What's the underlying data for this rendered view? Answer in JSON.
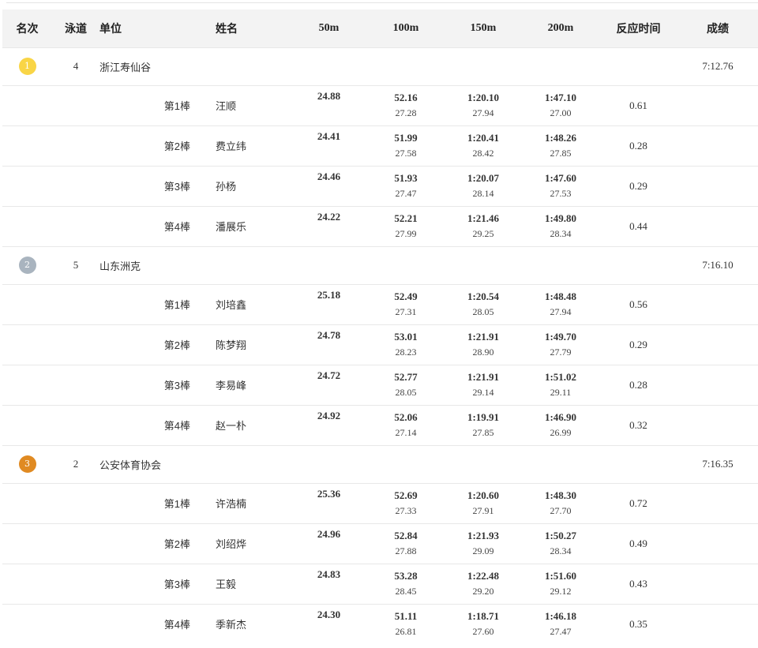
{
  "headers": {
    "rank": "名次",
    "lane": "泳道",
    "unit": "单位",
    "name": "姓名",
    "s50": "50m",
    "s100": "100m",
    "s150": "150m",
    "s200": "200m",
    "reaction": "反应时间",
    "result": "成绩"
  },
  "teams": [
    {
      "rank": "1",
      "medal_color": "#f9d546",
      "lane": "4",
      "unit": "浙江寿仙谷",
      "result": "7:12.76",
      "legs": [
        {
          "leg": "第1棒",
          "name": "汪顺",
          "s50": "24.88",
          "s100": "52.16",
          "s100_split": "27.28",
          "s150": "1:20.10",
          "s150_split": "27.94",
          "s200": "1:47.10",
          "s200_split": "27.00",
          "reaction": "0.61"
        },
        {
          "leg": "第2棒",
          "name": "费立纬",
          "s50": "24.41",
          "s100": "51.99",
          "s100_split": "27.58",
          "s150": "1:20.41",
          "s150_split": "28.42",
          "s200": "1:48.26",
          "s200_split": "27.85",
          "reaction": "0.28"
        },
        {
          "leg": "第3棒",
          "name": "孙杨",
          "s50": "24.46",
          "s100": "51.93",
          "s100_split": "27.47",
          "s150": "1:20.07",
          "s150_split": "28.14",
          "s200": "1:47.60",
          "s200_split": "27.53",
          "reaction": "0.29"
        },
        {
          "leg": "第4棒",
          "name": "潘展乐",
          "s50": "24.22",
          "s100": "52.21",
          "s100_split": "27.99",
          "s150": "1:21.46",
          "s150_split": "29.25",
          "s200": "1:49.80",
          "s200_split": "28.34",
          "reaction": "0.44"
        }
      ]
    },
    {
      "rank": "2",
      "medal_color": "#a9b4bf",
      "lane": "5",
      "unit": "山东洲克",
      "result": "7:16.10",
      "legs": [
        {
          "leg": "第1棒",
          "name": "刘培鑫",
          "s50": "25.18",
          "s100": "52.49",
          "s100_split": "27.31",
          "s150": "1:20.54",
          "s150_split": "28.05",
          "s200": "1:48.48",
          "s200_split": "27.94",
          "reaction": "0.56"
        },
        {
          "leg": "第2棒",
          "name": "陈梦翔",
          "s50": "24.78",
          "s100": "53.01",
          "s100_split": "28.23",
          "s150": "1:21.91",
          "s150_split": "28.90",
          "s200": "1:49.70",
          "s200_split": "27.79",
          "reaction": "0.29"
        },
        {
          "leg": "第3棒",
          "name": "李易峰",
          "s50": "24.72",
          "s100": "52.77",
          "s100_split": "28.05",
          "s150": "1:21.91",
          "s150_split": "29.14",
          "s200": "1:51.02",
          "s200_split": "29.11",
          "reaction": "0.28"
        },
        {
          "leg": "第4棒",
          "name": "赵一朴",
          "s50": "24.92",
          "s100": "52.06",
          "s100_split": "27.14",
          "s150": "1:19.91",
          "s150_split": "27.85",
          "s200": "1:46.90",
          "s200_split": "26.99",
          "reaction": "0.32"
        }
      ]
    },
    {
      "rank": "3",
      "medal_color": "#e08a22",
      "lane": "2",
      "unit": "公安体育协会",
      "result": "7:16.35",
      "legs": [
        {
          "leg": "第1棒",
          "name": "许浩楠",
          "s50": "25.36",
          "s100": "52.69",
          "s100_split": "27.33",
          "s150": "1:20.60",
          "s150_split": "27.91",
          "s200": "1:48.30",
          "s200_split": "27.70",
          "reaction": "0.72"
        },
        {
          "leg": "第2棒",
          "name": "刘绍烨",
          "s50": "24.96",
          "s100": "52.84",
          "s100_split": "27.88",
          "s150": "1:21.93",
          "s150_split": "29.09",
          "s200": "1:50.27",
          "s200_split": "28.34",
          "reaction": "0.49"
        },
        {
          "leg": "第3棒",
          "name": "王毅",
          "s50": "24.83",
          "s100": "53.28",
          "s100_split": "28.45",
          "s150": "1:22.48",
          "s150_split": "29.20",
          "s200": "1:51.60",
          "s200_split": "29.12",
          "reaction": "0.43"
        },
        {
          "leg": "第4棒",
          "name": "季新杰",
          "s50": "24.30",
          "s100": "51.11",
          "s100_split": "26.81",
          "s150": "1:18.71",
          "s150_split": "27.60",
          "s200": "1:46.18",
          "s200_split": "27.47",
          "reaction": "0.35"
        }
      ]
    }
  ]
}
